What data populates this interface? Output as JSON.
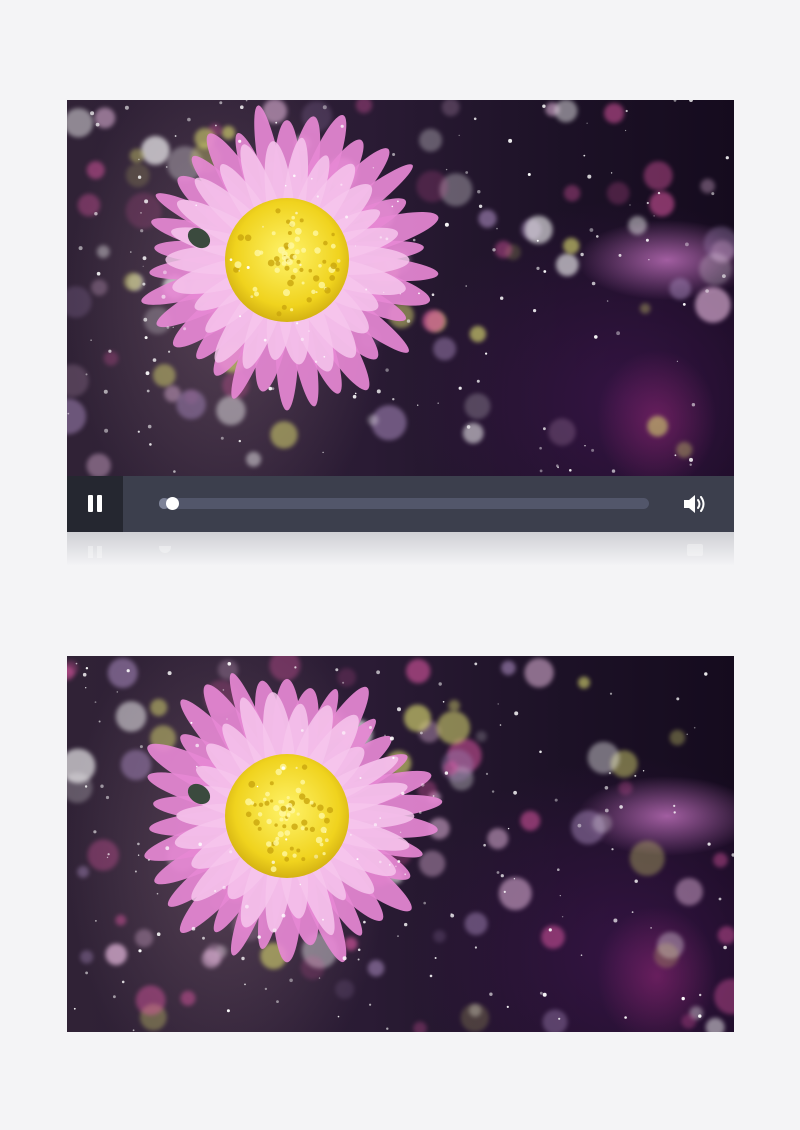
{
  "player": {
    "state": "playing",
    "progress_fraction": 0.02,
    "volume": "on",
    "controls": {
      "play_pause_icon": "pause-icon",
      "volume_icon": "volume-icon"
    }
  },
  "scene": {
    "subject": "pink-daisy-flower",
    "colors": {
      "petal": "#e688d4",
      "petal_light": "#f6c6ec",
      "center": "#f0d31e",
      "center_dark": "#c9a50e",
      "background": "#231730",
      "bokeh_pink": "#e65aa8",
      "bokeh_yellow": "#d8d870",
      "bokeh_white": "#ffffff"
    }
  },
  "colors": {
    "page_background": "#f4f4f6",
    "controls_bar": "#3c3f4d",
    "play_button": "#252730",
    "track": "#52566a",
    "knob": "#ffffff"
  }
}
